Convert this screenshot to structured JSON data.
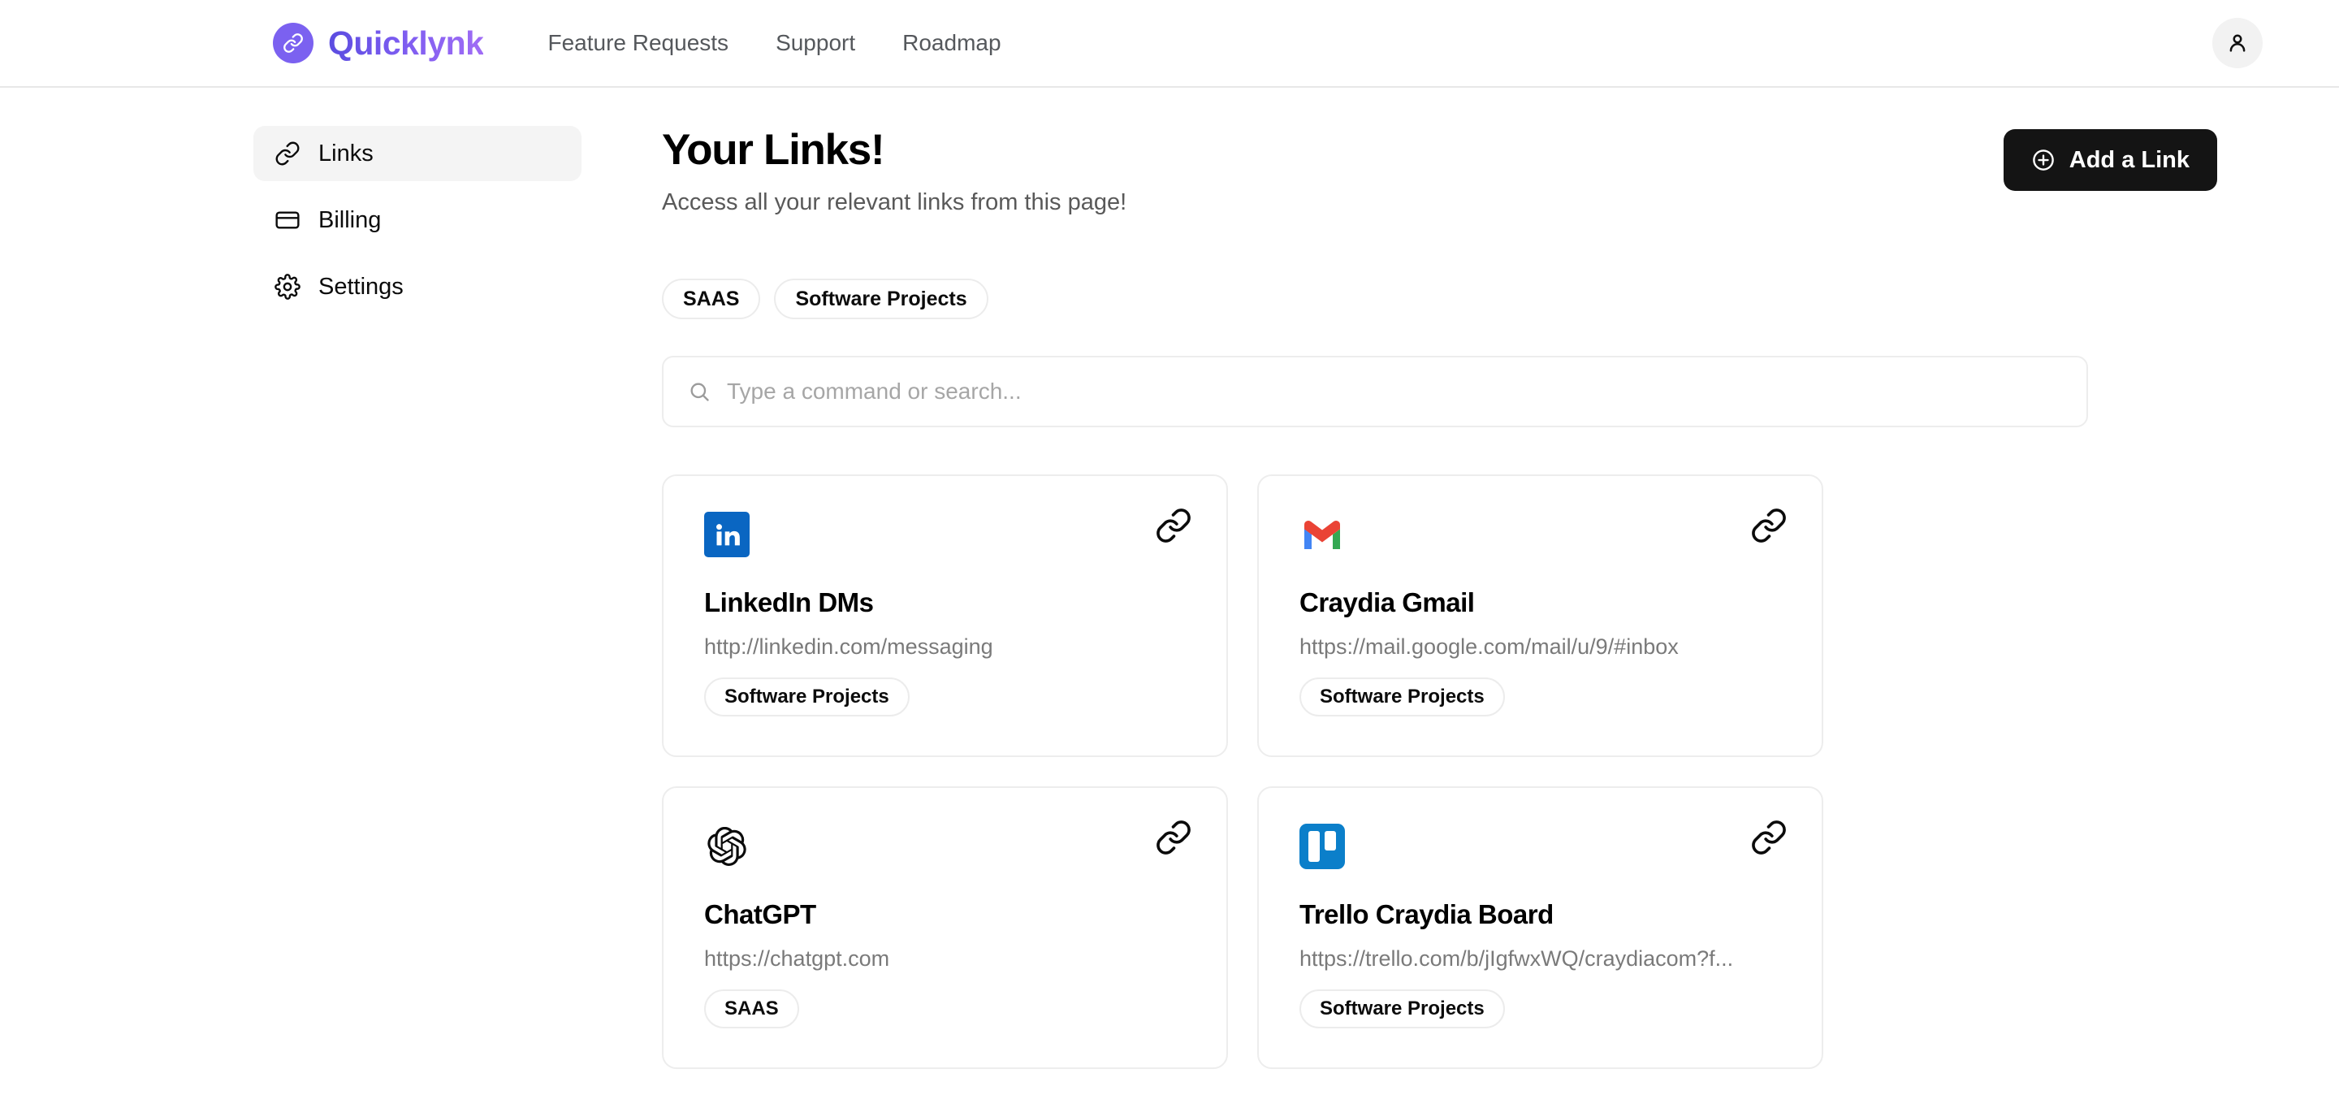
{
  "brand": {
    "name": "Quicklynk",
    "icon": "link-icon",
    "accent": "#7b61f0"
  },
  "topnav": {
    "items": [
      {
        "label": "Feature Requests"
      },
      {
        "label": "Support"
      },
      {
        "label": "Roadmap"
      }
    ],
    "avatar_icon": "user-icon"
  },
  "sidebar": {
    "items": [
      {
        "label": "Links",
        "icon": "link-icon",
        "active": true
      },
      {
        "label": "Billing",
        "icon": "credit-card-icon",
        "active": false
      },
      {
        "label": "Settings",
        "icon": "gear-icon",
        "active": false
      }
    ]
  },
  "page": {
    "title": "Your Links!",
    "subtitle": "Access all your relevant links from this page!",
    "add_button": {
      "label": "Add a Link",
      "icon": "plus-circle-icon",
      "bg": "#141414",
      "fg": "#ffffff"
    }
  },
  "filters": {
    "chips": [
      {
        "label": "SAAS"
      },
      {
        "label": "Software Projects"
      }
    ]
  },
  "search": {
    "placeholder": "Type a command or search...",
    "value": "",
    "icon": "search-icon"
  },
  "links": {
    "cards": [
      {
        "logo": "linkedin-logo",
        "title": "LinkedIn DMs",
        "url": "http://linkedin.com/messaging",
        "tag": "Software Projects",
        "action_icon": "chain-link-icon"
      },
      {
        "logo": "gmail-logo",
        "title": "Craydia Gmail",
        "url": "https://mail.google.com/mail/u/9/#inbox",
        "tag": "Software Projects",
        "action_icon": "chain-link-icon"
      },
      {
        "logo": "openai-logo",
        "title": "ChatGPT",
        "url": "https://chatgpt.com",
        "tag": "SAAS",
        "action_icon": "chain-link-icon"
      },
      {
        "logo": "trello-logo",
        "title": "Trello Craydia Board",
        "url": "https://trello.com/b/jIgfwxWQ/craydiacom?f...",
        "tag": "Software Projects",
        "action_icon": "chain-link-icon"
      }
    ]
  }
}
